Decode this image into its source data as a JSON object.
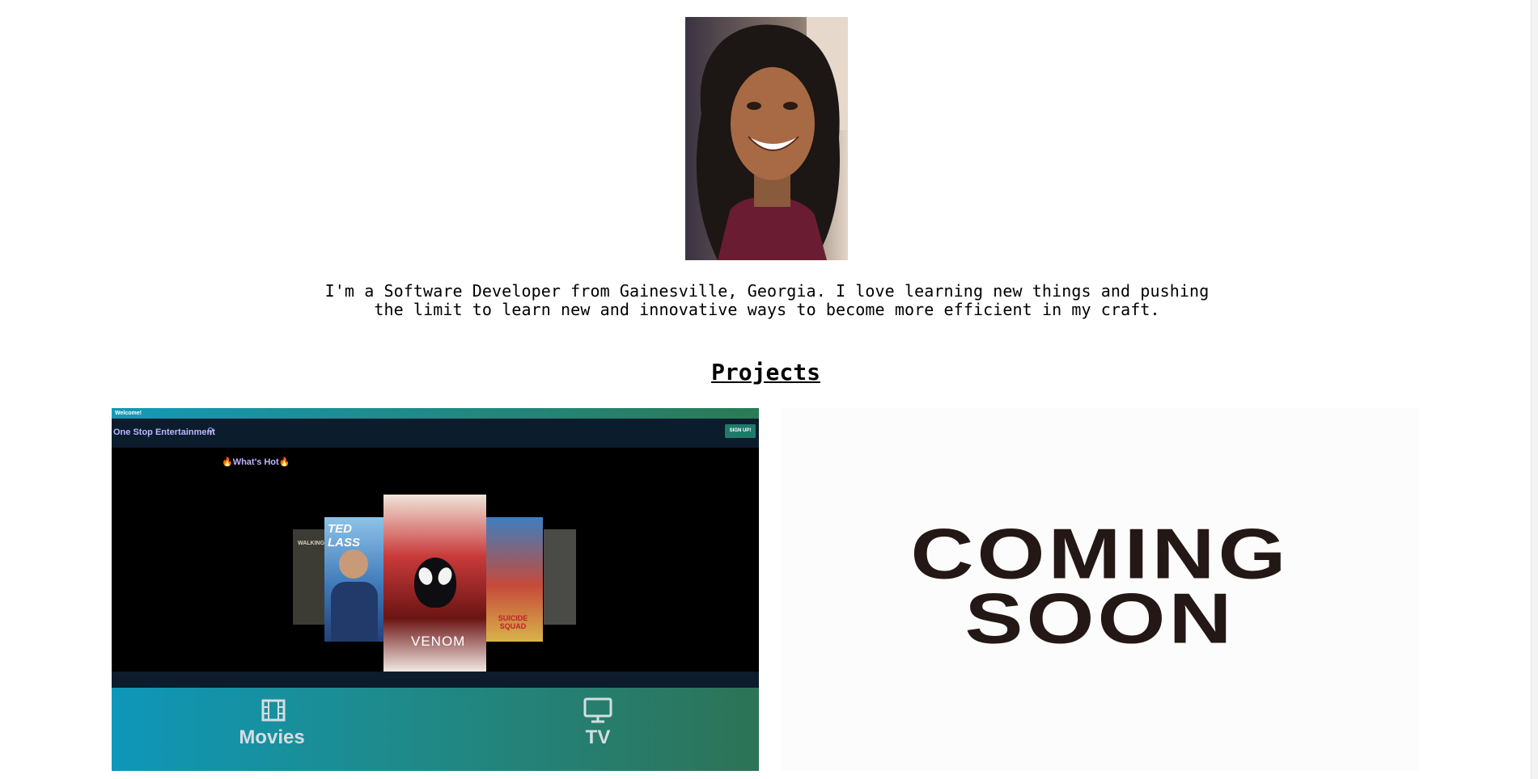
{
  "profile": {
    "photo_alt": "profile-photo"
  },
  "bio": {
    "line1": "I'm a Software Developer from Gainesville, Georgia. I love learning new things and pushing",
    "line2": "the limit to learn new and innovative ways to become more efficient in my craft."
  },
  "projects": {
    "heading": "Projects",
    "items": [
      {
        "welcome": "Welcome!",
        "brand": "One Stop Entertainment",
        "signup": "SIGN UP!",
        "whats_hot": "🔥What's Hot🔥",
        "posters": {
          "ted": "TED LASS",
          "venom": "VENOM",
          "suicide": "SUICIDE SQUAD",
          "walking": "WALKING"
        },
        "nav": {
          "movies": "Movies",
          "tv": "TV"
        }
      },
      {
        "line1": "COMING",
        "line2": "SOON"
      }
    ]
  },
  "colors": {
    "accent_purple": "#bcb6ff",
    "gradient_start": "#0e97b9",
    "gradient_end": "#2d7356"
  }
}
